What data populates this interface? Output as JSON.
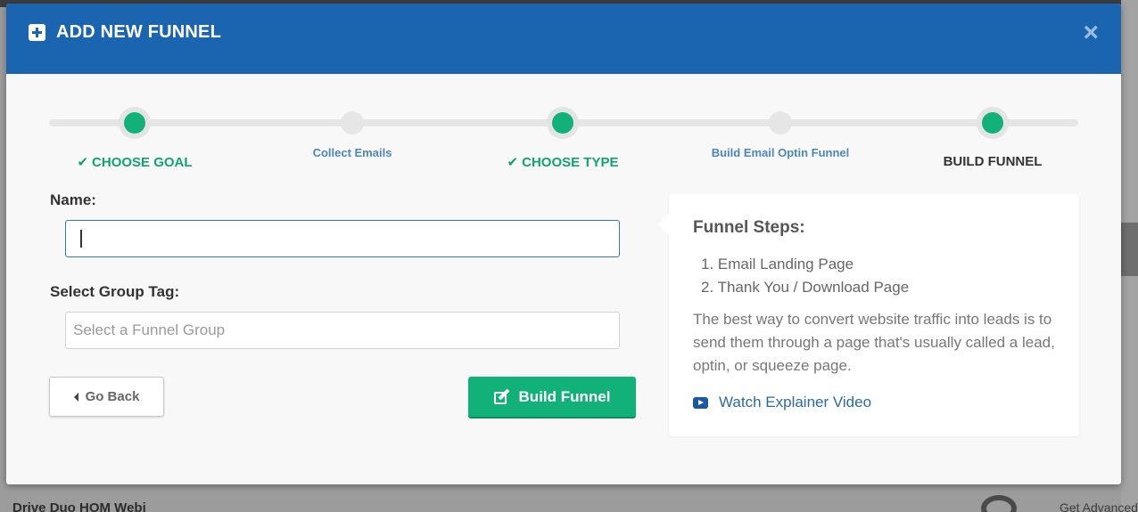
{
  "modal": {
    "title": "ADD NEW FUNNEL",
    "close_label": "×"
  },
  "steps": [
    {
      "label": "CHOOSE GOAL",
      "status": "done"
    },
    {
      "label": "Collect Emails",
      "status": "sub"
    },
    {
      "label": "CHOOSE TYPE",
      "status": "done"
    },
    {
      "label": "Build Email Optin Funnel",
      "status": "sub"
    },
    {
      "label": "BUILD FUNNEL",
      "status": "active"
    }
  ],
  "form": {
    "name_label": "Name:",
    "name_value": "",
    "group_label": "Select Group Tag:",
    "group_placeholder": "Select a Funnel Group"
  },
  "buttons": {
    "back": "Go Back",
    "build": "Build Funnel"
  },
  "info": {
    "title": "Funnel Steps:",
    "steps": [
      "1. Email Landing Page",
      "2. Thank You / Download Page"
    ],
    "description": "The best way to convert website traffic into leads is to send them through a page that's usually called a lead, optin, or squeeze page.",
    "video_link": "Watch Explainer Video"
  },
  "background": {
    "bottom_right_text": "Get Advanced",
    "bottom_left_text": "Drive Duo HOM Webi"
  },
  "colors": {
    "header": "#1b65b0",
    "accent_green": "#12b179",
    "link_blue": "#2b6aa5"
  }
}
